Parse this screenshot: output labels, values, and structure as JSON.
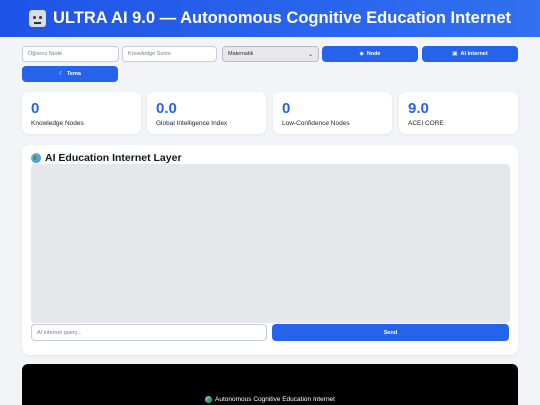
{
  "header": {
    "title": "ULTRA AI 9.0 — Autonomous Cognitive Education Internet",
    "icon": "robot-icon"
  },
  "controls": {
    "student_node_placeholder": "Öğrenci Node",
    "knowledge_score_placeholder": "Knowledge Score",
    "subject_select_value": "Matematik",
    "node_button_label": "Node",
    "ai_internet_button_label": "AI Internet",
    "theme_button_label": "Tema"
  },
  "stats": [
    {
      "value": "0",
      "label": "Knowledge Nodes"
    },
    {
      "value": "0.0",
      "label": "Global Intelligence Index"
    },
    {
      "value": "0",
      "label": "Low-Confidence Nodes"
    },
    {
      "value": "9.0",
      "label": "ACEI CORE"
    }
  ],
  "panel": {
    "title": "AI Education Internet Layer",
    "query_placeholder": "AI internet query...",
    "send_label": "Send"
  },
  "footer": {
    "text": "Autonomous Cognitive Education Internet"
  },
  "colors": {
    "accent": "#2563eb",
    "header": "#1e54e6",
    "background": "#f2f4f7",
    "footer": "#000000"
  }
}
